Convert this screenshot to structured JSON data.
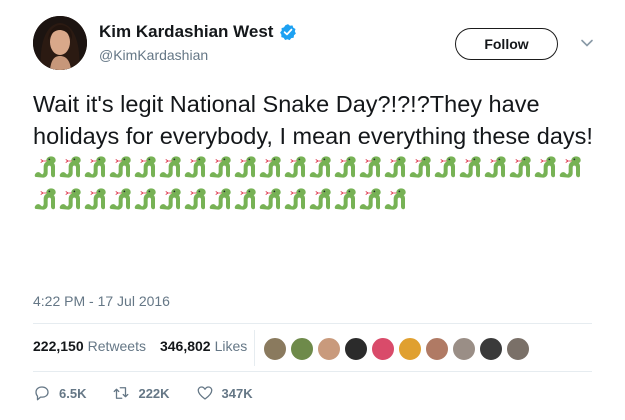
{
  "author": {
    "name": "Kim Kardashian West",
    "handle": "@KimKardashian",
    "verified": true
  },
  "follow_button": {
    "label": "Follow"
  },
  "tweet": {
    "text": "Wait it's legit National Snake Day?!?!?They have holidays for everybody, I mean everything these days!",
    "emoji": "snake",
    "emoji_count": 37,
    "timestamp": "4:22 PM - 17 Jul 2016"
  },
  "stats": {
    "retweets_value": "222,150",
    "retweets_label": "Retweets",
    "likes_value": "346,802",
    "likes_label": "Likes"
  },
  "actions": {
    "reply_count": "6.5K",
    "retweet_count": "222K",
    "like_count": "347K"
  },
  "colors": {
    "verified_blue": "#1da1f2",
    "snake_green": "#77b255",
    "muted": "#657786",
    "text": "#14171a"
  }
}
